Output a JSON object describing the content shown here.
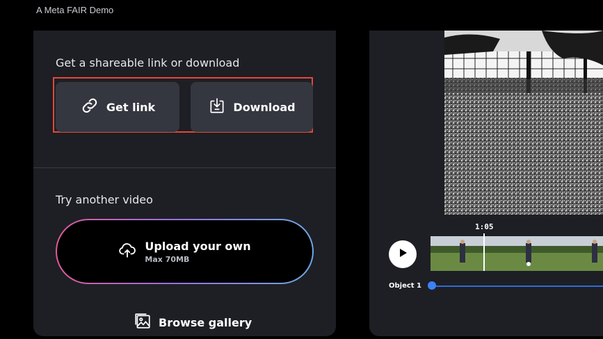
{
  "header": {
    "text": "A Meta FAIR Demo"
  },
  "share": {
    "title": "Get a shareable link or download",
    "get_link_label": "Get link",
    "download_label": "Download"
  },
  "another": {
    "title": "Try another video",
    "upload_label": "Upload your own",
    "upload_sub": "Max 70MB",
    "gallery_label": "Browse gallery"
  },
  "player": {
    "timecode": "1:05",
    "object_label": "Object 1"
  },
  "colors": {
    "panel": "#1d1f24",
    "button": "#343740",
    "highlight": "#e4483a",
    "track": "#3b82f6"
  }
}
